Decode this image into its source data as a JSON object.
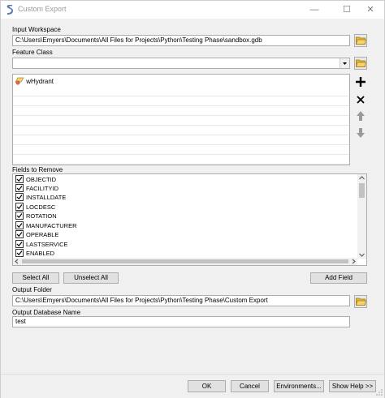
{
  "window": {
    "title": "Custom Export",
    "minimize_glyph": "—",
    "maximize_glyph": "☐",
    "close_glyph": "✕"
  },
  "input_workspace": {
    "label": "Input Workspace",
    "value": "C:\\Users\\Emyers\\Documents\\All Files for Projects\\Python\\Testing Phase\\sandbox.gdb"
  },
  "feature_class": {
    "label": "Feature Class",
    "value": "",
    "items": [
      {
        "label": "wHydrant"
      }
    ]
  },
  "fields_to_remove": {
    "label": "Fields to Remove",
    "fields": [
      {
        "name": "OBJECTID",
        "checked": true
      },
      {
        "name": "FACILITYID",
        "checked": true
      },
      {
        "name": "INSTALLDATE",
        "checked": true
      },
      {
        "name": "LOCDESC",
        "checked": true
      },
      {
        "name": "ROTATION",
        "checked": true
      },
      {
        "name": "MANUFACTURER",
        "checked": true
      },
      {
        "name": "OPERABLE",
        "checked": true
      },
      {
        "name": "LASTSERVICE",
        "checked": true
      },
      {
        "name": "ENABLED",
        "checked": true
      }
    ]
  },
  "buttons": {
    "select_all": "Select All",
    "unselect_all": "Unselect All",
    "add_field": "Add Field",
    "ok": "OK",
    "cancel": "Cancel",
    "environments": "Environments...",
    "show_help": "Show Help >>"
  },
  "output_folder": {
    "label": "Output Folder",
    "value": "C:\\Users\\Emyers\\Documents\\All Files for Projects\\Python\\Testing Phase\\Custom Export"
  },
  "output_database_name": {
    "label": "Output Database Name",
    "value": "test"
  }
}
